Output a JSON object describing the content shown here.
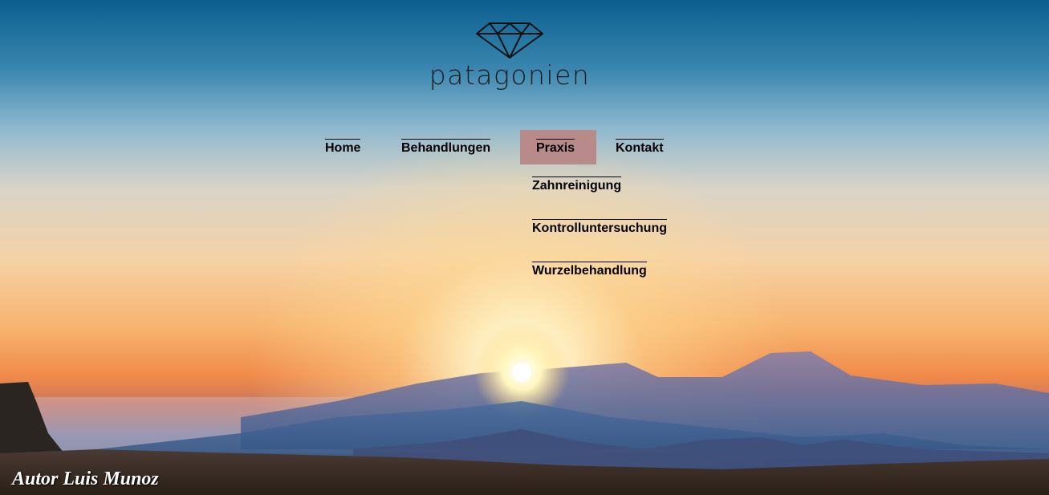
{
  "brand": {
    "name": "patagonien",
    "icon": "diamond-icon"
  },
  "nav": {
    "items": [
      {
        "label": "Home",
        "active": false
      },
      {
        "label": "Behandlungen",
        "active": false
      },
      {
        "label": "Praxis",
        "active": true
      },
      {
        "label": "Kontakt",
        "active": false
      }
    ],
    "active_color": "#b98a8a"
  },
  "dropdown": {
    "items": [
      {
        "label": "Zahnreinigung"
      },
      {
        "label": "Kontrolluntersuchung"
      },
      {
        "label": "Wurzelbehandlung"
      }
    ]
  },
  "footer": {
    "author": "Autor Luis Munoz"
  }
}
